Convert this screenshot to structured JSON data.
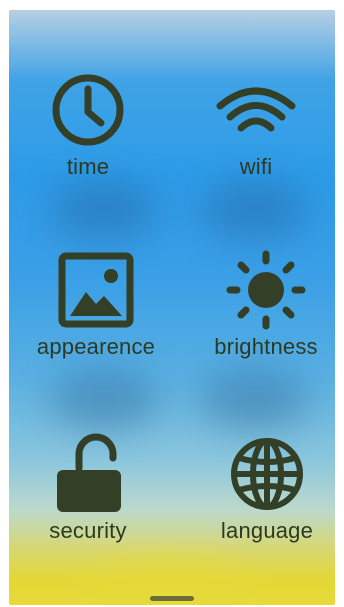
{
  "tiles": [
    {
      "id": "time",
      "label": "time",
      "icon": "clock-icon"
    },
    {
      "id": "wifi",
      "label": "wifi",
      "icon": "wifi-icon"
    },
    {
      "id": "appearance",
      "label": "appearence",
      "icon": "image-icon"
    },
    {
      "id": "brightness",
      "label": "brightness",
      "icon": "sun-icon"
    },
    {
      "id": "security",
      "label": "security",
      "icon": "unlocked-padlock-icon"
    },
    {
      "id": "language",
      "label": "language",
      "icon": "globe-icon"
    }
  ],
  "colors": {
    "icon": "#333f26",
    "label": "#2b3a24"
  }
}
